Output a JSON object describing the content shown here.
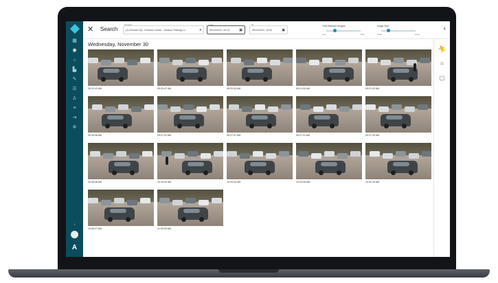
{
  "app": {
    "logo_text": "",
    "powered_by": ""
  },
  "topbar": {
    "title": "Search",
    "camera_label": "Camera",
    "camera_value": "(1)  Demark HQ - Execute Center - Outdoor Parking Lo",
    "from_label": "From",
    "from_value": "09/13/2022, 09:13",
    "to_label": "To",
    "to_value": "09/14/2022, 15:00",
    "slider1_title": "Time Between Images",
    "slider1_min": "Less",
    "slider1_max": "More",
    "slider1_value": 0.25,
    "slider2_title": "Image Size",
    "slider2_min": "Small",
    "slider2_max": "Large",
    "slider2_value": 0.2
  },
  "content": {
    "date_heading": "Wednesday, November 30",
    "tiles": [
      {
        "time": "09:20:42 AM"
      },
      {
        "time": "09:20:47 AM"
      },
      {
        "time": "09:20:53 AM"
      },
      {
        "time": "09:21:00 AM"
      },
      {
        "time": "09:21:20 AM"
      },
      {
        "time": "09:26:06 AM"
      },
      {
        "time": "09:27:41 AM"
      },
      {
        "time": "09:27:47 AM"
      },
      {
        "time": "09:27:41 AM"
      },
      {
        "time": "09:27:29 AM"
      },
      {
        "time": "09:48:38 AM"
      },
      {
        "time": "10:16:43 AM"
      },
      {
        "time": "10:20:00 AM"
      },
      {
        "time": "10:29:06 AM"
      },
      {
        "time": "10:42:18 AM"
      },
      {
        "time": "10:46:37 AM"
      },
      {
        "time": "11:09:30 AM"
      }
    ]
  },
  "colors": {
    "sidebar": "#0b4d5c",
    "accent": "#1a8fb0",
    "rail_active": "#f1b400"
  },
  "icons": {
    "sidebar": [
      "grid-icon",
      "eye-icon",
      "home-icon",
      "chart-icon",
      "wrench-icon",
      "report-icon",
      "user-icon",
      "sliders-icon",
      "logout-icon",
      "gear-icon"
    ],
    "rail": [
      "run-icon",
      "scan-icon",
      "car-scan-icon"
    ]
  }
}
